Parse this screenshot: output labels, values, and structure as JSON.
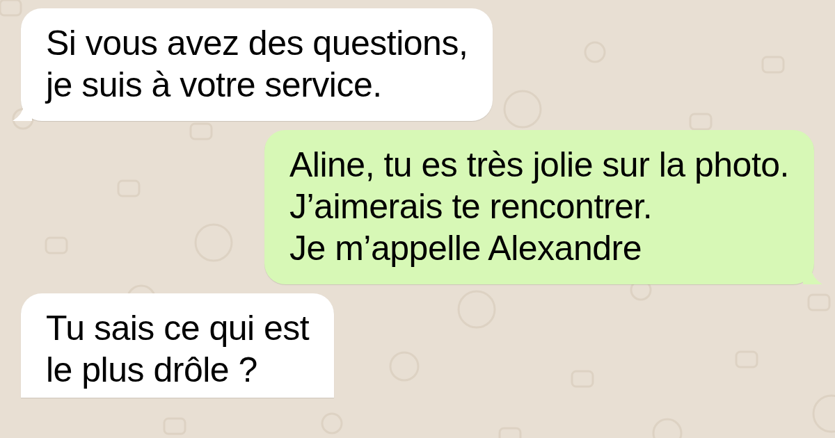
{
  "messages": [
    {
      "kind": "incoming",
      "text": "Si vous avez des questions,\nje suis à votre service."
    },
    {
      "kind": "outgoing",
      "text": "Aline, tu es très jolie sur la photo.\nJ’aimerais te rencontrer.\nJe m’appelle Alexandre"
    },
    {
      "kind": "incoming",
      "text": "Tu sais ce qui est\nle plus drôle ?"
    }
  ]
}
